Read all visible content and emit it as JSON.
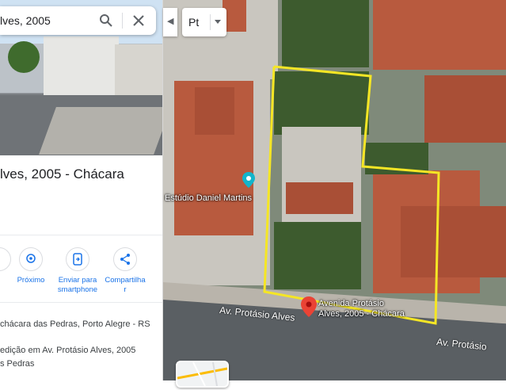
{
  "search": {
    "value": "lves, 2005"
  },
  "place": {
    "title": "lves, 2005 - Chácara"
  },
  "actions": [
    {
      "label": "Próximo",
      "icon": "nearby-icon"
    },
    {
      "label": "Enviar para smartphone",
      "label_lines": [
        "Enviar para",
        "smartphone"
      ],
      "icon": "send-to-phone-icon"
    },
    {
      "label": "Compartilhar",
      "label_lines": [
        "Compartilha",
        "r"
      ],
      "icon": "share-icon"
    }
  ],
  "details": {
    "address": "chácara das Pedras, Porto Alegre - RS",
    "building_line1": "edição em Av. Protásio Alves, 2005",
    "building_line2": "s Pedras"
  },
  "map": {
    "layer_button": "Pt",
    "business_label": "Estúdio Daniel Martins",
    "pin_label_line1": "Avenida Protásio",
    "pin_label_line2": "Alves, 2005 - Chácara",
    "street_label_1": "Av. Protásio Alves",
    "street_label_2": "Av. Protásio",
    "outline_color": "#f5e625",
    "pin_color": "#ea4335"
  },
  "colors": {
    "accent": "#1a73e8",
    "text": "#202124"
  }
}
